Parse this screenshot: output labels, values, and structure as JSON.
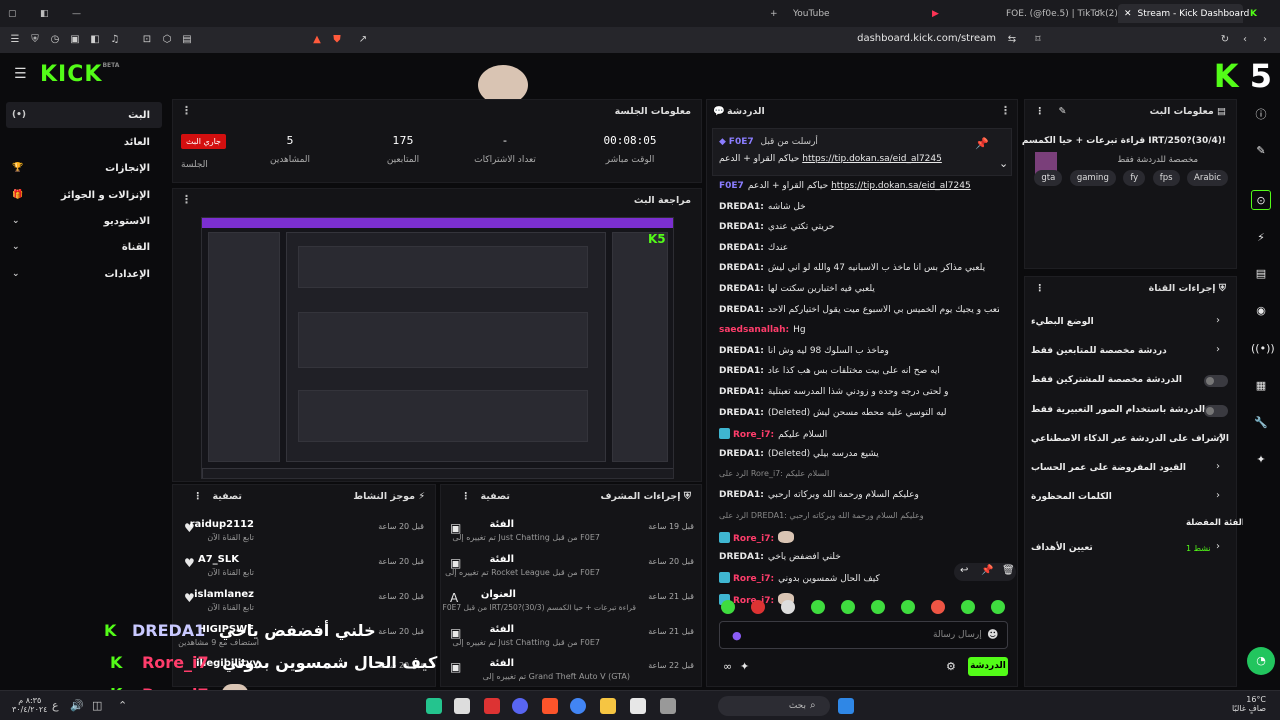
{
  "browser": {
    "tabs": [
      {
        "label": "YouTube"
      },
      {
        "label": "FOE. (@f0e.5) | TikTok(2)"
      },
      {
        "label": "Stream - Kick Dashboard"
      }
    ],
    "url": "dashboard.kick.com/stream"
  },
  "header": {
    "logo": "KICK",
    "logo_sup": "BETA",
    "brand_corner": "5"
  },
  "nav": {
    "items": [
      {
        "label": "البث",
        "active": true
      },
      {
        "label": "العائد"
      },
      {
        "label": "الإنجازات"
      },
      {
        "label": "الإنزالات و الجوائز"
      },
      {
        "label": "الاستوديو"
      },
      {
        "label": "القناة"
      },
      {
        "label": "الإعدادات"
      }
    ]
  },
  "session": {
    "title": "معلومات الجلسة",
    "live_badge": "جاري البث",
    "session_label": "الجلسة",
    "stats": [
      {
        "value": "00:08:05",
        "label": "الوقت مباشر"
      },
      {
        "value": "-",
        "label": "تعداد الاشتراكات"
      },
      {
        "value": "175",
        "label": "المتابعين"
      },
      {
        "value": "5",
        "label": "المشاهدين"
      }
    ]
  },
  "preview": {
    "title": "مراجعة البث"
  },
  "activity": {
    "title": "موجز النشاط",
    "filter": "تصفية",
    "rows": [
      {
        "name": "raidup2112",
        "sub": "تابع القناة الآن",
        "time": "قبل 20 ساعة"
      },
      {
        "name": "A7_SLK",
        "sub": "تابع القناة الآن",
        "time": "قبل 20 ساعة"
      },
      {
        "name": "islamlanez",
        "sub": "تابع القناة الآن",
        "time": "قبل 20 ساعة"
      },
      {
        "name": "HIGIPSWF",
        "sub": "استضاف مع 9 مشاهدين",
        "time": "قبل 20 ساعة"
      },
      {
        "name": "illegibilityy",
        "sub": "",
        "time": "قبل 20 ساعة"
      }
    ]
  },
  "modactions": {
    "title": "إجراءات المشرف",
    "filter": "تصفية",
    "rows": [
      {
        "name": "الفئة",
        "sub": "تم تغييره إلى Just Chatting من قبل F0E7",
        "time": "قبل 19 ساعة"
      },
      {
        "name": "الفئة",
        "sub": "تم تغييره إلى Rocket League من قبل F0E7",
        "time": "قبل 20 ساعة"
      },
      {
        "name": "العنوان",
        "sub": "F0E7 من قبل IRT/250?(30/3) قراءة تبرعات + حيا الكمسم",
        "time": "قبل 21 ساعة"
      },
      {
        "name": "الفئة",
        "sub": "تم تغييره إلى Just Chatting من قبل F0E7",
        "time": "قبل 21 ساعة"
      },
      {
        "name": "الفئة",
        "sub": "تم تغييره إلى Grand Theft Auto V (GTA)",
        "time": "قبل 22 ساعة"
      }
    ]
  },
  "chat": {
    "title": "الدردشة",
    "pinned": {
      "author": "F0E7",
      "by": "أرسلت من قبل",
      "text": "حياكم القراو + الدعم",
      "link": "https://tip.dokan.sa/eid_al7245"
    },
    "messages": [
      {
        "user": "F0E7",
        "cls": "foe",
        "text": "حياكم القراو + الدعم ",
        "link": "https://tip.dokan.sa/eid_al7245"
      },
      {
        "user": "DREDA1:",
        "cls": "dreda",
        "text": "خل شاشه"
      },
      {
        "user": "DREDA1:",
        "cls": "dreda",
        "text": "حريتي تكتي عندي"
      },
      {
        "user": "DREDA1:",
        "cls": "dreda",
        "text": "عندك"
      },
      {
        "user": "DREDA1:",
        "cls": "dreda",
        "text": "يلعبي مذاكر بس انا ماخذ ب الاسبانيه 47 والله لو اني ليش"
      },
      {
        "user": "DREDA1:",
        "cls": "dreda",
        "text": "يلعبي فيه اختبارين سكتت لها"
      },
      {
        "user": "DREDA1:",
        "cls": "dreda",
        "text": "اسبوع كامل يتعب و يجيك يوم الخميس بي الاسبوع ميت يقول اختياركم الاحد"
      },
      {
        "user": "saedsanallah:",
        "cls": "saed",
        "text": "Hg"
      },
      {
        "user": "DREDA1:",
        "cls": "dreda",
        "text": "وماخذ ب السلوك 98 ليه وش انا"
      },
      {
        "user": "DREDA1:",
        "cls": "dreda",
        "text": "ايه صح انه على بيت مختلفات بس هب كذا عاد"
      },
      {
        "user": "DREDA1:",
        "cls": "dreda",
        "text": "و لحتى درجه وحده و زودني شذا المدرسه تعبتلية"
      },
      {
        "user": "DREDA1:",
        "cls": "dreda",
        "text": "(Deleted) ليه التوسي عليه محطه مسحن ليش"
      },
      {
        "user": "Rore_i7:",
        "cls": "rore",
        "text": "السلام عليكم"
      },
      {
        "user": "DREDA1:",
        "cls": "dreda",
        "text": "(Deleted) يشيع مدرسه بيلي"
      },
      {
        "user": "",
        "cls": "reply",
        "text": "الرد على Rore_i7: السلام عليكم"
      },
      {
        "user": "DREDA1:",
        "cls": "dreda",
        "text": "وعليكم السلام ورحمة الله وبركاته ارحبي"
      },
      {
        "user": "",
        "cls": "reply",
        "text": "الرد على DREDA1: وعليكم السلام ورحمة الله وبركاته ارحبي"
      },
      {
        "user": "Rore_i7:",
        "cls": "rore",
        "text": ""
      },
      {
        "user": "DREDA1:",
        "cls": "dreda",
        "text": "خلني أفضفض ياخي"
      },
      {
        "user": "Rore_i7:",
        "cls": "rore",
        "text": "كيف الحال شمسوين بدوني"
      },
      {
        "user": "Rore_i7:",
        "cls": "rore",
        "text": ""
      }
    ],
    "input_placeholder": "إرسال رسالة",
    "send": "الدردشة"
  },
  "stream_info": {
    "title": "معلومات البث",
    "stream_title": "قراءة تبرعات + حيا الكمسم IRT/250?(30/4)!",
    "category": "مخصصة للدردشة فقط",
    "tags": [
      "gta",
      "gaming",
      "fy",
      "fps",
      "Arabic"
    ]
  },
  "channel_actions": {
    "title": "إجراءات القناة",
    "items": [
      {
        "label": "الوضع البطيء",
        "kind": "chevron"
      },
      {
        "label": "دردشة مخصصة للمتابعين فقط",
        "kind": "chevron"
      },
      {
        "label": "الدردشة مخصصة للمشتركين فقط",
        "kind": "toggle"
      },
      {
        "label": "الدردشة باستخدام الصور التعبيرية فقط",
        "kind": "toggle"
      },
      {
        "label": "الإشراف على الدردشة عبر الذكاء الاصطناعي",
        "kind": "ext"
      },
      {
        "label": "القيود المفروضة على عمر الحساب",
        "kind": "chevron"
      },
      {
        "label": "الكلمات المحظورة",
        "kind": "chevron"
      }
    ],
    "fav_category": "الفئة المفضلة",
    "goal": "تعيين الأهداف",
    "goal_status": "نشط 1"
  },
  "overlay": {
    "lines": [
      {
        "user": "DREDA1",
        "text": "خلني أفضفض ياخي"
      },
      {
        "user": "Rore_i7",
        "text": "كيف الحال شمسوين بدوني"
      },
      {
        "user": "Rore_i7",
        "text": ""
      }
    ]
  },
  "taskbar": {
    "search": "بحث",
    "clock": "٨:٣٥ م",
    "date": "٣٠/٤/٢٠٢٤",
    "weather": "16°C",
    "weather_desc": "صافٍ غالبًا"
  }
}
